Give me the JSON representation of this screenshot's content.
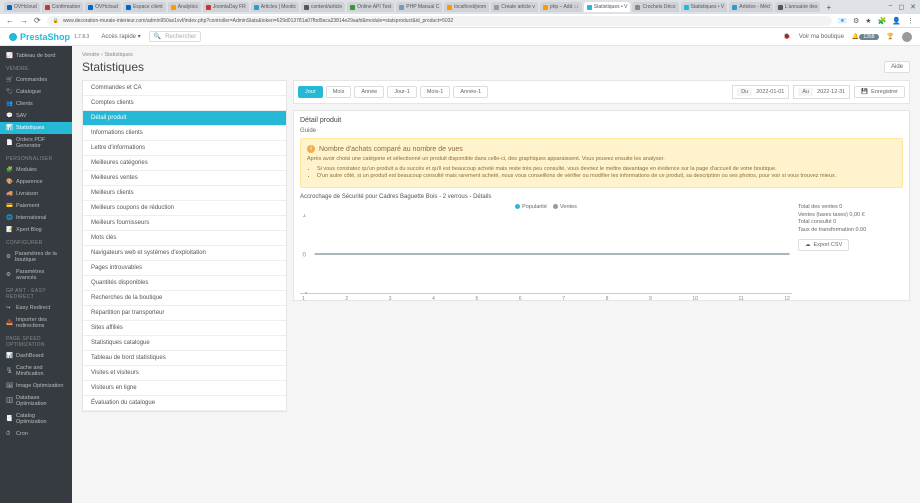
{
  "browser": {
    "tabs": [
      {
        "label": "OVHcloud"
      },
      {
        "label": "Confirmation"
      },
      {
        "label": "OVHcloud"
      },
      {
        "label": "Espace client"
      },
      {
        "label": "Analytics"
      },
      {
        "label": "JoomlaDay FR"
      },
      {
        "label": "Articles | Mootic"
      },
      {
        "label": "content/article"
      },
      {
        "label": "Online API Test"
      },
      {
        "label": "PHP Manual C"
      },
      {
        "label": "localhost/joom"
      },
      {
        "label": "Create article v"
      },
      {
        "label": "php – Add ↕↕"
      },
      {
        "label": "Statistiques • V"
      },
      {
        "label": "Crochets Déco"
      },
      {
        "label": "Statistiques • V"
      },
      {
        "label": "Articles - Méd"
      },
      {
        "label": "L'annuaire des"
      }
    ],
    "url": "www.decoration-murale-interieur.com/admin950ax1xvf/index.php?controller=AdminStats&token=629d013781a07fbd9aca23814e29aafd&module=statsproduct&id_product=5032"
  },
  "header": {
    "logo": "PrestaShop",
    "version": "1.7.8.3",
    "quick": "Accès rapide ▾",
    "search_placeholder": "Rechercher",
    "shop": "Voir ma boutique",
    "badge": "1358"
  },
  "sidebar": {
    "dashboard": "Tableau de bord",
    "sections": [
      {
        "title": "VENDRE",
        "items": [
          "Commandes",
          "Catalogue",
          "Clients",
          "SAV",
          "Statistiques",
          "Orders PDF Generator"
        ]
      },
      {
        "title": "PERSONNALISER",
        "items": [
          "Modules",
          "Apparence",
          "Livraison",
          "Paiement",
          "International",
          "Xpert Blog"
        ]
      },
      {
        "title": "CONFIGURER",
        "items": [
          "Paramètres de la boutique",
          "Paramètres avancés"
        ]
      },
      {
        "title": "GP ANT - EASY REDIRECT",
        "items": [
          "Easy Redirect",
          "Importer des redirections"
        ]
      },
      {
        "title": "PAGE SPEED OPTIMIZATION",
        "items": [
          "DashBoard",
          "Cache and Minification",
          "Image Optimization",
          "Database Optimization",
          "Catalog Optimization",
          "Cron"
        ]
      }
    ]
  },
  "breadcrumb": {
    "a": "Vendre",
    "b": "Statistiques"
  },
  "page": {
    "title": "Statistiques",
    "help": "Aide"
  },
  "submenu": [
    "Commandes et CA",
    "Comptes clients",
    "Détail produit",
    "Informations clients",
    "Lettre d'informations",
    "Meilleures catégories",
    "Meilleures ventes",
    "Meilleurs clients",
    "Meilleurs coupons de réduction",
    "Meilleurs fournisseurs",
    "Mots clés",
    "Navigateurs web et systèmes d'exploitation",
    "Pages introuvables",
    "Quantités disponibles",
    "Recherches de la boutique",
    "Répartition par transporteur",
    "Sites affiliés",
    "Statistiques catalogue",
    "Tableau de bord statistiques",
    "Visites et visiteurs",
    "Visiteurs en ligne",
    "Évaluation du catalogue"
  ],
  "toolbar": {
    "periods": [
      "Jour",
      "Mois",
      "Année",
      "Jour-1",
      "Mois-1",
      "Année-1"
    ],
    "from_label": "Du",
    "from": "2022-01-01",
    "to_label": "Au",
    "to": "2022-12-31",
    "save": "Enregistrer"
  },
  "detail": {
    "title": "Détail produit",
    "guide": "Guide",
    "alert_title": "Nombre d'achats comparé au nombre de vues",
    "alert_intro": "Après avoir choisi une catégorie et sélectionné un produit disponible dans celle-ci, des graphiques apparaissent. Vous pouvez ensuite les analyser.",
    "alert_li1": "Si vous constatez qu'un produit a du succès et qu'il est beaucoup acheté mais reste très peu consulté, vous devriez le mettre davantage en évidence sur la page d'accueil de votre boutique.",
    "alert_li2": "D'un autre côté, si un produit est beaucoup consulté mais rarement acheté, nous vous conseillons de vérifier ou modifier les informations de ce produit, sa description ou ses photos, pour voir si vous trouvez mieux.",
    "chart_label": "Accrochage de Sécurité pour Cadres Baguette Bois - 2 verrous - Détails",
    "legend": {
      "pop": "Popularité",
      "ventes": "Ventes",
      "pop_color": "#2fb5d2",
      "ventes_color": "#999"
    },
    "stats": {
      "l1": "Total des ventes 0",
      "l2": "Ventes (taxes taxes) 0,00 €",
      "l3": "Total consulté 0",
      "l4": "Taux de transformation 0.00"
    },
    "export": "Export CSV"
  },
  "chart_data": {
    "type": "line",
    "x": [
      1,
      2,
      3,
      4,
      5,
      6,
      7,
      8,
      9,
      10,
      11,
      12
    ],
    "series": [
      {
        "name": "Popularité",
        "values": [
          0,
          0,
          0,
          0,
          0,
          0,
          0,
          0,
          0,
          0,
          0,
          0
        ]
      },
      {
        "name": "Ventes",
        "values": [
          0,
          0,
          0,
          0,
          0,
          0,
          0,
          0,
          0,
          0,
          0,
          0
        ]
      }
    ],
    "ylim": [
      -1,
      1
    ],
    "yticks": [
      -1,
      0,
      1
    ]
  }
}
